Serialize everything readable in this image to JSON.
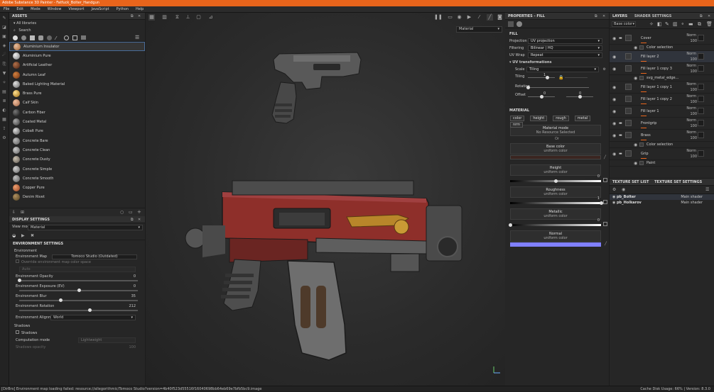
{
  "title": "Adobe Substance 3D Painter - Fatfuck_Bolter_Handgun",
  "menu": [
    "File",
    "Edit",
    "Mode",
    "Window",
    "Viewport",
    "JavaScript",
    "Python",
    "Help"
  ],
  "colors": {
    "accent": "#e8641b",
    "selection": "#4a6c98",
    "base_color": "#3a2520",
    "normal_color": "#8080ff"
  },
  "assets": {
    "title": "ASSETS",
    "library": "All libraries",
    "search": "Search",
    "items": [
      "Aluminium Insulator",
      "Aluminium Pure",
      "Artificial Leather",
      "Autumn Leaf",
      "Baked Lighting Material",
      "Brass Pure",
      "Calf Skin",
      "Carbon Fiber",
      "Coated Metal",
      "Cobalt Pure",
      "Concrete Bare",
      "Concrete Clean",
      "Concrete Dusty",
      "Concrete Simple",
      "Concrete Smooth",
      "Copper Pure",
      "Denim Rivet"
    ],
    "selected": "Aluminium Insulator"
  },
  "display": {
    "title": "DISPLAY SETTINGS",
    "view_mode_label": "View mode",
    "view_mode": "Material",
    "env_header": "ENVIRONMENT SETTINGS",
    "env_section": "Environment",
    "env_map_label": "Environment Map",
    "env_map_value": "Tomoco Studio (Outdated)",
    "override_label": "Override environment map color space",
    "auto": "Auto",
    "opacity_label": "Environment Opacity",
    "opacity": "0",
    "exposure_label": "Environment Exposure (EV)",
    "exposure": "0",
    "blur_label": "Environment Blur",
    "blur": "35",
    "rotation_label": "Environment Rotation",
    "rotation": "212",
    "alignment_label": "Environment Alignment",
    "alignment": "World",
    "shadows_section": "Shadows",
    "shadows_check": "Shadows",
    "computation_label": "Computation mode",
    "computation": "Lightweight",
    "shadow_opacity_label": "Shadows opacity",
    "shadow_opacity": "100"
  },
  "viewport": {
    "mode_select": "Material",
    "axis_label": "L"
  },
  "properties": {
    "title": "PROPERTIES - FILL",
    "fill": "FILL",
    "projection_label": "Projection",
    "projection": "UV projection",
    "filtering_label": "Filtering",
    "filtering": "Bilinear | HQ",
    "uvwrap_label": "UV Wrap",
    "uvwrap": "Repeat",
    "uvtrans": "UV transformations",
    "scale_label": "Scale",
    "scale": "Tiling",
    "tiling_label": "Tiling",
    "tiling": "1",
    "rotation_label": "Rotation",
    "rotation": "0",
    "offset_label": "Offset",
    "offset_x": "0",
    "offset_y": "0",
    "material": "MATERIAL",
    "channels": [
      "color",
      "height",
      "rough",
      "metal",
      "nrm"
    ],
    "material_mode": "Material mode",
    "no_resource": "No Resource Selected",
    "or": "Or",
    "base_color": "Base color",
    "uniform": "uniform color",
    "height": "Height",
    "height_val": "0",
    "roughness": "Roughness",
    "roughness_val": "1",
    "metallic": "Metallic",
    "metallic_val": "0",
    "normal": "Normal"
  },
  "layers": {
    "tab1": "LAYERS",
    "tab2": "SHADER SETTINGS",
    "channel": "Base color",
    "norm": "Norm",
    "op": "100",
    "rows": [
      {
        "name": "Cover",
        "level": 0,
        "type": "folder"
      },
      {
        "name": "Color selection",
        "level": 1,
        "type": "mask"
      },
      {
        "name": "Fill layer 2",
        "level": 0,
        "type": "fill"
      },
      {
        "name": "Fill layer 1 copy 3",
        "level": 0,
        "type": "fill"
      },
      {
        "name": "svg_metal_edge...",
        "level": 1,
        "type": "mask"
      },
      {
        "name": "Fill layer 1 copy 1",
        "level": 0,
        "type": "fill"
      },
      {
        "name": "Fill layer 1 copy 2",
        "level": 0,
        "type": "fill"
      },
      {
        "name": "Fill layer 1",
        "level": 0,
        "type": "fill"
      },
      {
        "name": "Frontgrip",
        "level": 0,
        "type": "folder"
      },
      {
        "name": "Brass",
        "level": 0,
        "type": "folder"
      },
      {
        "name": "Color selection",
        "level": 1,
        "type": "mask"
      },
      {
        "name": "Grip",
        "level": 0,
        "type": "folder"
      },
      {
        "name": "Paint",
        "level": 1,
        "type": "paint"
      }
    ]
  },
  "texture_sets": {
    "tab1": "TEXTURE SET LIST",
    "tab2": "TEXTURE SET SETTINGS",
    "rows": [
      {
        "name": "pb_Bolter",
        "shader": "Main shader"
      },
      {
        "name": "pb_Holkarov",
        "shader": "Main shader"
      }
    ]
  },
  "status": {
    "message": "[DirBrs] Environment map loading failed: resource://allegorithmic/Tomoco Studio?version=4b40f523d55516f16040698bb64eb69e7bfb5bc9.image",
    "disk": "Cache Disk Usage: 66% | Version: 8.3.0"
  }
}
